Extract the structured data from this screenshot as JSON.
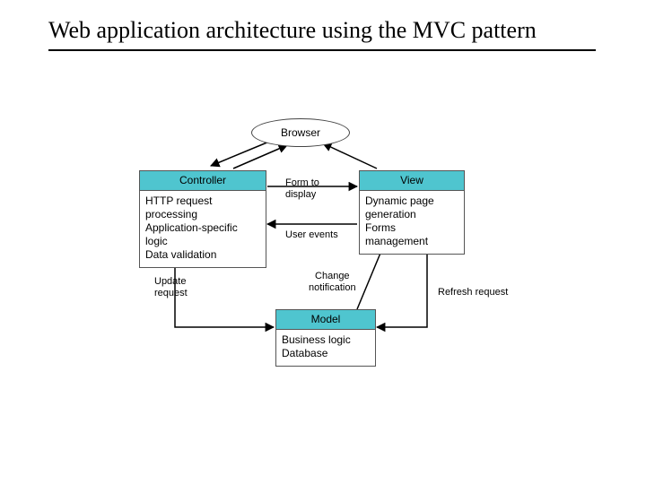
{
  "title": "Web application architecture using the MVC pattern",
  "browser": {
    "label": "Browser"
  },
  "controller": {
    "header": "Controller",
    "line1": "HTTP request processing",
    "line2": "Application-specific logic",
    "line3": "Data validation"
  },
  "view": {
    "header": "View",
    "line1": "Dynamic page",
    "line2": "generation",
    "line3": "Forms management"
  },
  "model": {
    "header": "Model",
    "line1": "Business logic",
    "line2": "Database"
  },
  "labels": {
    "form_to_display": "Form to display",
    "user_events": "User events",
    "change_notification": "Change notification",
    "update_request": "Update request",
    "refresh_request": "Refresh request"
  },
  "colors": {
    "box_header": "#4fc5cf"
  }
}
